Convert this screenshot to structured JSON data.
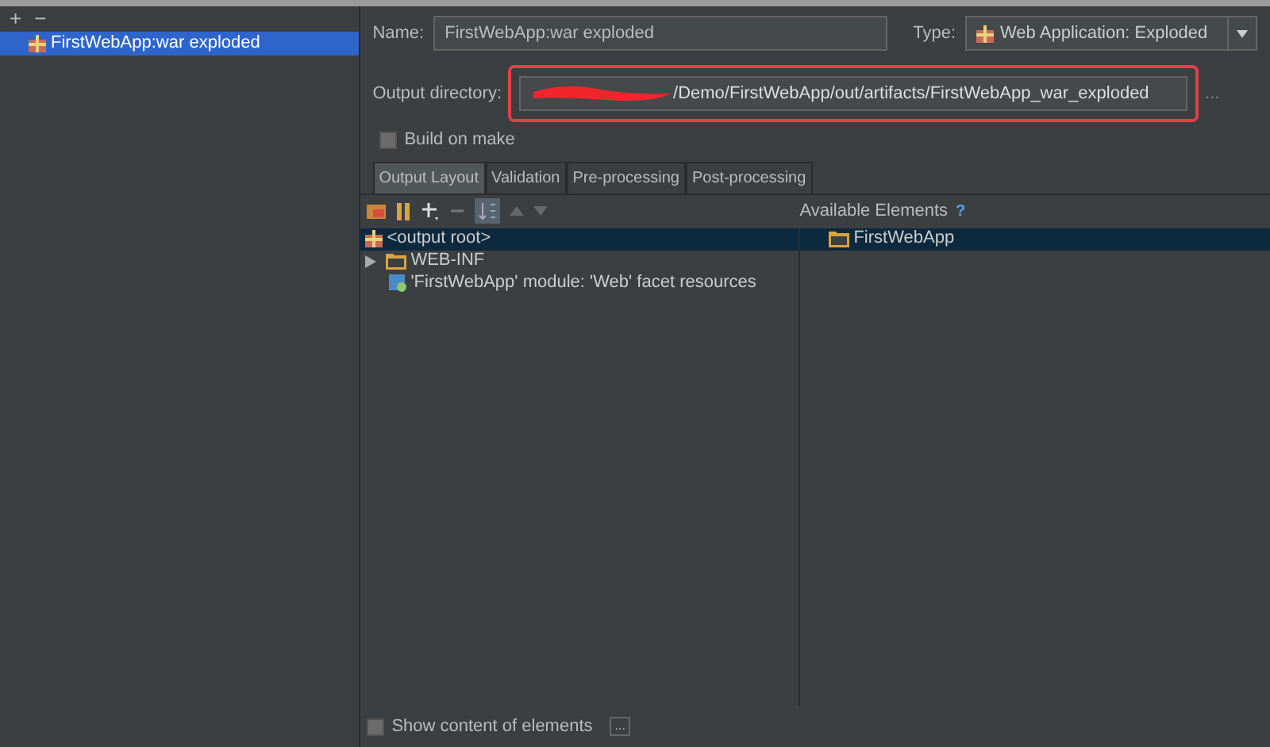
{
  "sidebar": {
    "toolbar": [
      "+",
      "−"
    ],
    "items": [
      {
        "label": "FirstWebApp:war exploded",
        "selected": true
      }
    ]
  },
  "name_field": {
    "label": "Name:",
    "value": "FirstWebApp:war exploded"
  },
  "type_field": {
    "label": "Type:",
    "value": "Web Application: Exploded"
  },
  "output_directory": {
    "label": "Output directory:",
    "value": "/Demo/FirstWebApp/out/artifacts/FirstWebApp_war_exploded",
    "highlighted": true,
    "redacted": true,
    "browse": "..."
  },
  "build_on_make": {
    "label": "Build on make",
    "checked": false
  },
  "tabs": [
    {
      "label": "Output Layout",
      "selected": true
    },
    {
      "label": "Validation",
      "selected": false
    },
    {
      "label": "Pre-processing",
      "selected": false
    },
    {
      "label": "Post-processing",
      "selected": false
    }
  ],
  "available_elements": {
    "label": "Available Elements",
    "help": "?"
  },
  "layout_tree": [
    {
      "label": "<output root>",
      "kind": "root",
      "selected": true
    },
    {
      "label": "WEB-INF",
      "kind": "folder",
      "selected": false
    },
    {
      "label": "'FirstWebApp' module: 'Web' facet resources",
      "kind": "module",
      "selected": false
    }
  ],
  "available_tree": [
    {
      "label": "FirstWebApp",
      "selected": true
    }
  ],
  "show_content": {
    "label": "Show content of elements",
    "checked": false,
    "more": "..."
  }
}
